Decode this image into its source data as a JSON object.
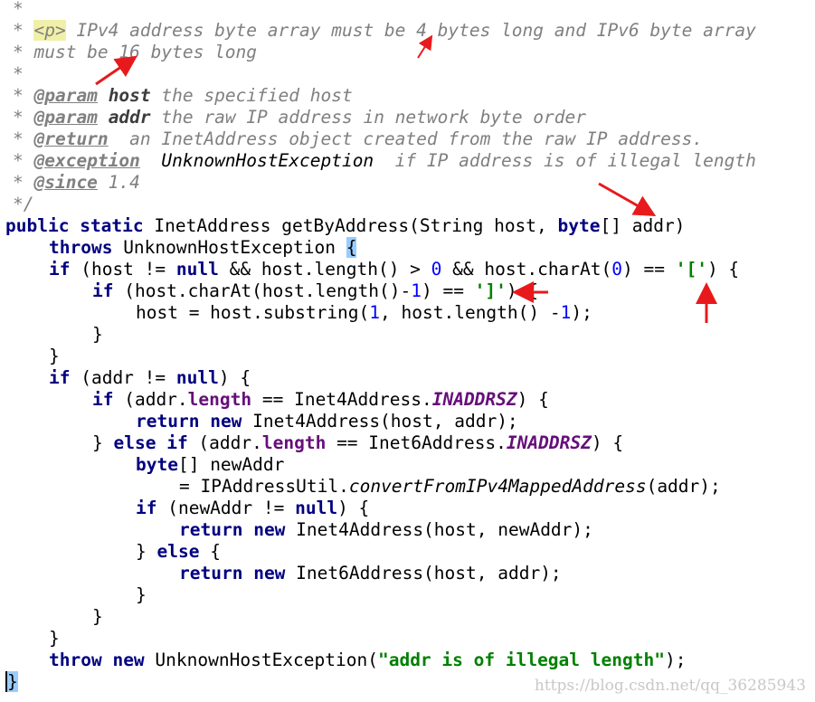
{
  "code": {
    "l1": [
      "*"
    ],
    "l2": [
      "* ",
      "<p>",
      " IPv4 address byte array must be 4 bytes long and IPv6 byte array"
    ],
    "l3": [
      "* must be 16 bytes long"
    ],
    "l4": [
      "*"
    ],
    "l5": [
      "* ",
      "@param",
      " ",
      "host",
      " the specified host"
    ],
    "l6": [
      "* ",
      "@param",
      " ",
      "addr",
      " the raw IP address in network byte order"
    ],
    "l7": [
      "* ",
      "@return",
      "  an InetAddress object created from the raw IP address."
    ],
    "l8": [
      "* ",
      "@exception",
      "  UnknownHostException",
      "  if IP address is of illegal length"
    ],
    "l9": [
      "* ",
      "@since",
      " 1.4"
    ],
    "l10": [
      "*/"
    ],
    "l11": [
      "public",
      " ",
      "static",
      " InetAddress getByAddress(String host, ",
      "byte",
      "[] addr)"
    ],
    "l12": [
      "throws",
      " UnknownHostException ",
      "{"
    ],
    "l13": [
      "if",
      " (host != ",
      "null",
      " && host.length() > ",
      "0",
      " && host.charAt(",
      "0",
      ") == ",
      "'['",
      ") {"
    ],
    "l14": [
      "if",
      " (host.charAt(host.length()-",
      "1",
      ") == ",
      "']'",
      ") {"
    ],
    "l15": [
      "host = host.substring(",
      "1",
      ", host.length() -",
      "1",
      ");"
    ],
    "l16": [
      "}"
    ],
    "l17": [
      "}"
    ],
    "l18": [
      "if",
      " (addr != ",
      "null",
      ") {"
    ],
    "l19": [
      "if",
      " (addr.",
      "length",
      " == Inet4Address.",
      "INADDRSZ",
      ") {"
    ],
    "l20": [
      "return",
      " ",
      "new",
      " Inet4Address(host, addr);"
    ],
    "l21": [
      "} ",
      "else",
      " ",
      "if",
      " (addr.",
      "length",
      " == Inet6Address.",
      "INADDRSZ",
      ") {"
    ],
    "l22": [
      "byte",
      "[] newAddr"
    ],
    "l23": [
      "= IPAddressUtil.",
      "convertFromIPv4MappedAddress",
      "(addr);"
    ],
    "l24": [
      "if",
      " (newAddr != ",
      "null",
      ") {"
    ],
    "l25": [
      "return",
      " ",
      "new",
      " Inet4Address(host, newAddr);"
    ],
    "l26": [
      "} ",
      "else",
      " {"
    ],
    "l27": [
      "return",
      " ",
      "new",
      " Inet6Address(host, addr);"
    ],
    "l28": [
      "}"
    ],
    "l29": [
      "}"
    ],
    "l30": [
      "}"
    ],
    "l31": [
      "throw",
      " ",
      "new",
      " UnknownHostException(",
      "\"addr is of illegal length\"",
      ");"
    ],
    "l32": [
      "}"
    ]
  },
  "watermark": "https://blog.csdn.net/qq_36285943",
  "colors": {
    "keyword": "#000080",
    "comment": "#808080",
    "string": "#008000",
    "number": "#0000ff",
    "field": "#660e7a",
    "annotation_arrow": "#e8191c",
    "brace_highlight": "#99ccff"
  }
}
